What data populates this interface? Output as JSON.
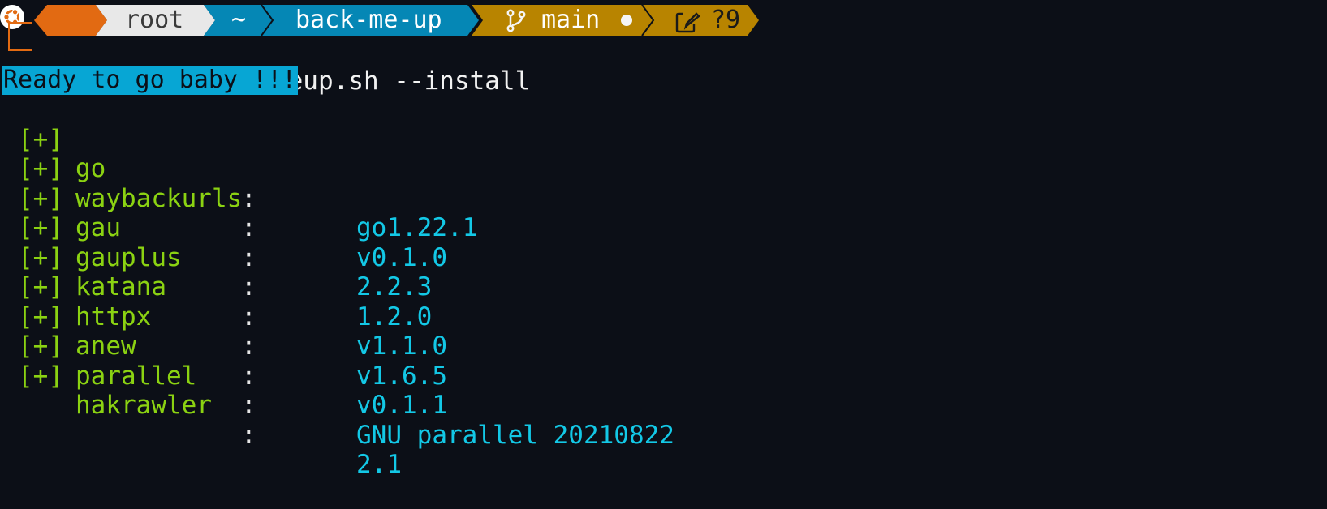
{
  "prompt": {
    "os_icon": "ubuntu-icon",
    "user": "root",
    "home": "~",
    "directory": "back-me-up",
    "git_branch_icon": "git-branch-icon",
    "git_branch": "main",
    "git_dirty_icon": "dot-icon",
    "git_changes_icon": "edit-icon",
    "git_untracked": "?9",
    "symbol": "#",
    "command": "bash backmeup.sh --install"
  },
  "output": {
    "banner": "Ready to go baby !!!",
    "tools": [
      {
        "mark": "[+]",
        "name": "go",
        "colon": ":",
        "version": "go1.22.1"
      },
      {
        "mark": "[+]",
        "name": "waybackurls",
        "colon": ":",
        "version": "v0.1.0"
      },
      {
        "mark": "[+]",
        "name": "gau",
        "colon": ":",
        "version": "2.2.3"
      },
      {
        "mark": "[+]",
        "name": "gauplus",
        "colon": ":",
        "version": "1.2.0"
      },
      {
        "mark": "[+]",
        "name": "katana",
        "colon": ":",
        "version": "v1.1.0"
      },
      {
        "mark": "[+]",
        "name": "httpx",
        "colon": ":",
        "version": "v1.6.5"
      },
      {
        "mark": "[+]",
        "name": "anew",
        "colon": ":",
        "version": "v0.1.1"
      },
      {
        "mark": "[+]",
        "name": "parallel",
        "colon": ":",
        "version": "GNU parallel 20210822"
      },
      {
        "mark": "[+]",
        "name": "hakrawler",
        "colon": ":",
        "version": "2.1"
      }
    ]
  },
  "colors": {
    "background": "#0c0f17",
    "os_segment": "#e26a12",
    "user_segment": "#e8e8e8",
    "path_segment": "#0587b5",
    "git_segment": "#b88400",
    "banner": "#07a6d4",
    "tool_name": "#8bd212",
    "version": "#13c8e6"
  }
}
